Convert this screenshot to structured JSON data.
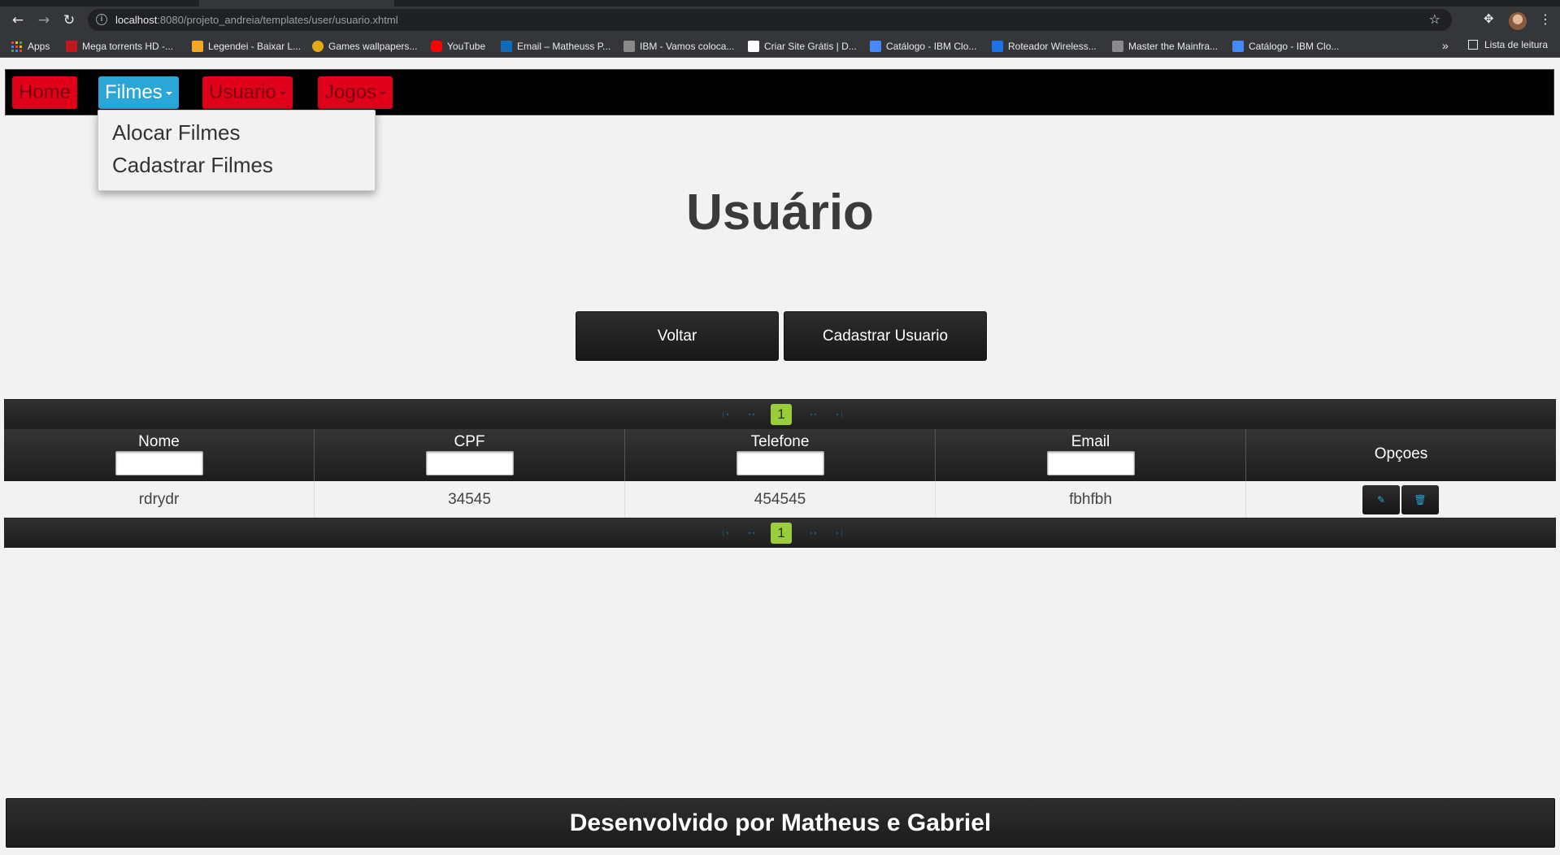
{
  "browser": {
    "url_host": "localhost",
    "url_rest": ":8080/projeto_andreia/templates/user/usuario.xhtml",
    "bookmarks": [
      {
        "label": "Apps",
        "icon": "apps-grid-icon",
        "color": "#4285f4"
      },
      {
        "label": "Mega torrents HD -...",
        "icon": "hd-favicon",
        "color": "#c4161c"
      },
      {
        "label": "Legendei - Baixar L...",
        "icon": "legendei-favicon",
        "color": "#f5a623"
      },
      {
        "label": "Games wallpapers...",
        "icon": "w-favicon",
        "color": "#e6a817"
      },
      {
        "label": "YouTube",
        "icon": "youtube-icon",
        "color": "#ff0000"
      },
      {
        "label": "Email – Matheuss P...",
        "icon": "outlook-icon",
        "color": "#0f6cbd"
      },
      {
        "label": "IBM - Vamos coloca...",
        "icon": "ibm-icon",
        "color": "#8a8a8a"
      },
      {
        "label": "Criar Site Grátis | D...",
        "icon": "wix-icon",
        "color": "#ffffff"
      },
      {
        "label": "Catálogo - IBM Clo...",
        "icon": "ibm-cloud-icon",
        "color": "#4589ff"
      },
      {
        "label": "Roteador Wireless...",
        "icon": "router-favicon",
        "color": "#1a73e8"
      },
      {
        "label": "Master the Mainfra...",
        "icon": "ibm-icon",
        "color": "#8a8a8a"
      },
      {
        "label": "Catálogo - IBM Clo...",
        "icon": "ibm-cloud-icon",
        "color": "#4589ff"
      }
    ],
    "reading_list": "Lista de leitura",
    "more_glyph": "»"
  },
  "nav": {
    "items": [
      {
        "label": "Home",
        "state": "normal"
      },
      {
        "label": "Filmes",
        "state": "active"
      },
      {
        "label": "Usuario",
        "state": "normal"
      },
      {
        "label": "Jogos",
        "state": "normal"
      }
    ],
    "dropdown": [
      "Alocar Filmes",
      "Cadastrar Filmes"
    ],
    "colors": {
      "red": "#e00019",
      "active": "#2aa6d9"
    }
  },
  "page": {
    "title": "Usuário",
    "buttons": {
      "back": "Voltar",
      "register": "Cadastrar Usuario"
    }
  },
  "table": {
    "columns": [
      "Nome",
      "CPF",
      "Telefone",
      "Email",
      "Opçoes"
    ],
    "rows": [
      {
        "nome": "rdrydr",
        "cpf": "34545",
        "telefone": "454545",
        "email": "fbhfbh"
      }
    ],
    "pager": {
      "first": "|◂",
      "prev": "◂◂",
      "current": "1",
      "next": "▸▸",
      "last": "▸|"
    },
    "actions": {
      "edit_icon": "edit-pencil-icon",
      "delete_icon": "trash-icon"
    }
  },
  "footer": {
    "text": "Desenvolvido por Matheus e Gabriel"
  }
}
